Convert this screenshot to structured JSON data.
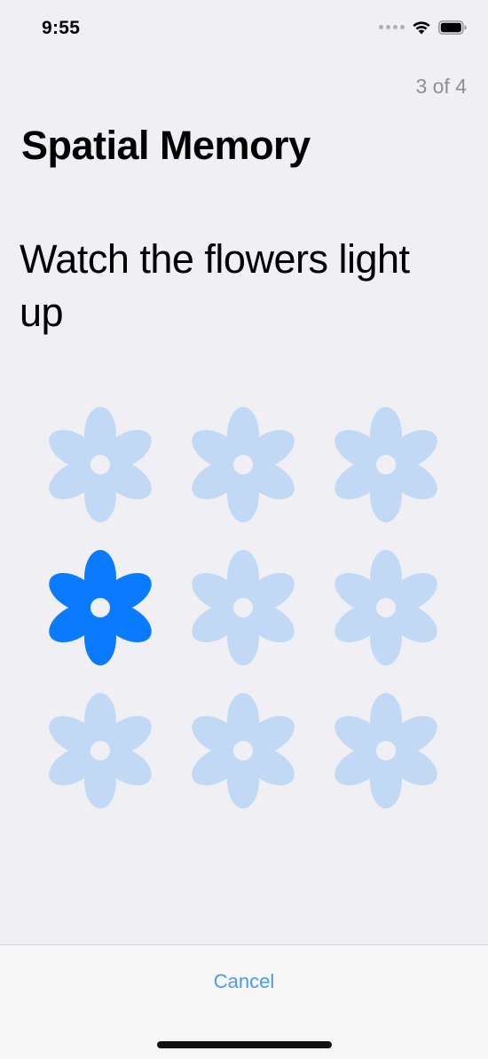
{
  "status_bar": {
    "time": "9:55",
    "icons": [
      "signal-dots-icon",
      "wifi-icon",
      "battery-icon"
    ]
  },
  "header": {
    "step_counter": "3 of 4",
    "title": "Spatial Memory"
  },
  "main": {
    "instruction": "Watch the flowers light up",
    "flower_grid": {
      "rows": 3,
      "columns": 3,
      "lit_index": 3,
      "flowers": [
        {
          "row": 1,
          "col": 1,
          "lit": false
        },
        {
          "row": 1,
          "col": 2,
          "lit": false
        },
        {
          "row": 1,
          "col": 3,
          "lit": false
        },
        {
          "row": 2,
          "col": 1,
          "lit": true
        },
        {
          "row": 2,
          "col": 2,
          "lit": false
        },
        {
          "row": 2,
          "col": 3,
          "lit": false
        },
        {
          "row": 3,
          "col": 1,
          "lit": false
        },
        {
          "row": 3,
          "col": 2,
          "lit": false
        },
        {
          "row": 3,
          "col": 3,
          "lit": false
        }
      ]
    }
  },
  "footer": {
    "cancel_label": "Cancel"
  },
  "colors": {
    "background": "#efeff4",
    "flower_lit": "#0a7aff",
    "flower_dim": "#c2d9f5",
    "accent": "#4a9bea"
  }
}
